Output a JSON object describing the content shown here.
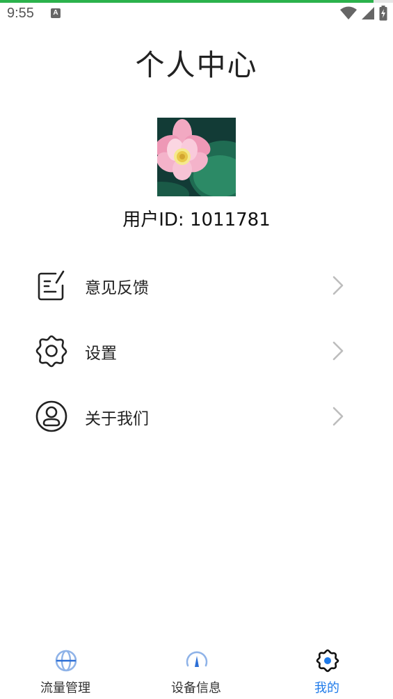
{
  "status_bar": {
    "time": "9:55",
    "notification_letter": "A"
  },
  "page": {
    "title": "个人中心",
    "progress": 0.95
  },
  "profile": {
    "user_id_text": "用户ID: 1011781",
    "avatar_icon": "lotus-flower-photo"
  },
  "menu": {
    "items": [
      {
        "label": "意见反馈",
        "icon": "feedback-icon"
      },
      {
        "label": "设置",
        "icon": "settings-gear-icon"
      },
      {
        "label": "关于我们",
        "icon": "about-user-icon"
      }
    ]
  },
  "bottom_nav": {
    "tabs": [
      {
        "label": "流量管理",
        "icon": "globe-icon",
        "active": false
      },
      {
        "label": "设备信息",
        "icon": "gauge-icon",
        "active": false
      },
      {
        "label": "我的",
        "icon": "gear-icon",
        "active": true
      }
    ]
  },
  "colors": {
    "accent": "#1f7bea",
    "progress": "#2bb24c",
    "nav_icon_light": "#7aa7e6"
  }
}
